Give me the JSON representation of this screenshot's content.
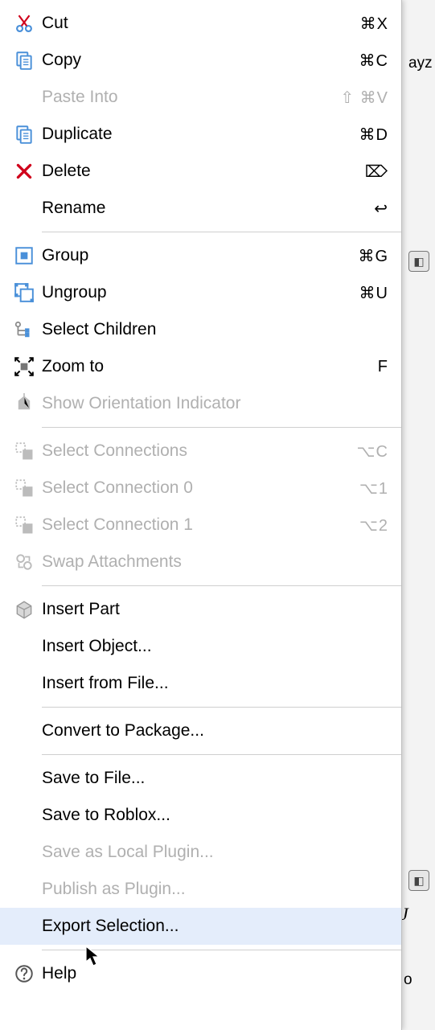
{
  "menu": {
    "sections": [
      [
        {
          "id": "cut",
          "label": "Cut",
          "shortcut": "⌘X",
          "disabled": false,
          "icon": "cut-icon"
        },
        {
          "id": "copy",
          "label": "Copy",
          "shortcut": "⌘C",
          "disabled": false,
          "icon": "copy-icon"
        },
        {
          "id": "paste-into",
          "label": "Paste Into",
          "shortcut": "⇧ ⌘V",
          "disabled": true,
          "icon": ""
        },
        {
          "id": "duplicate",
          "label": "Duplicate",
          "shortcut": "⌘D",
          "disabled": false,
          "icon": "duplicate-icon"
        },
        {
          "id": "delete",
          "label": "Delete",
          "shortcut": "⌦",
          "disabled": false,
          "icon": "delete-icon"
        },
        {
          "id": "rename",
          "label": "Rename",
          "shortcut": "↩",
          "disabled": false,
          "icon": ""
        }
      ],
      [
        {
          "id": "group",
          "label": "Group",
          "shortcut": "⌘G",
          "disabled": false,
          "icon": "group-icon"
        },
        {
          "id": "ungroup",
          "label": "Ungroup",
          "shortcut": "⌘U",
          "disabled": false,
          "icon": "ungroup-icon"
        },
        {
          "id": "select-children",
          "label": "Select Children",
          "shortcut": "",
          "disabled": false,
          "icon": "select-children-icon"
        },
        {
          "id": "zoom-to",
          "label": "Zoom to",
          "shortcut": "F",
          "disabled": false,
          "icon": "zoom-to-icon"
        },
        {
          "id": "show-orientation",
          "label": "Show Orientation Indicator",
          "shortcut": "",
          "disabled": true,
          "icon": "orientation-icon"
        }
      ],
      [
        {
          "id": "select-connections",
          "label": "Select Connections",
          "shortcut": "⌥C",
          "disabled": true,
          "icon": "select-connections-icon"
        },
        {
          "id": "select-connection-0",
          "label": "Select Connection 0",
          "shortcut": "⌥1",
          "disabled": true,
          "icon": "select-connection-0-icon"
        },
        {
          "id": "select-connection-1",
          "label": "Select Connection 1",
          "shortcut": "⌥2",
          "disabled": true,
          "icon": "select-connection-1-icon"
        },
        {
          "id": "swap-attachments",
          "label": "Swap Attachments",
          "shortcut": "",
          "disabled": true,
          "icon": "swap-attachments-icon"
        }
      ],
      [
        {
          "id": "insert-part",
          "label": "Insert Part",
          "shortcut": "",
          "disabled": false,
          "icon": "insert-part-icon"
        },
        {
          "id": "insert-object",
          "label": "Insert Object...",
          "shortcut": "",
          "disabled": false,
          "icon": ""
        },
        {
          "id": "insert-from-file",
          "label": "Insert from File...",
          "shortcut": "",
          "disabled": false,
          "icon": ""
        }
      ],
      [
        {
          "id": "convert-to-package",
          "label": "Convert to Package...",
          "shortcut": "",
          "disabled": false,
          "icon": ""
        }
      ],
      [
        {
          "id": "save-to-file",
          "label": "Save to File...",
          "shortcut": "",
          "disabled": false,
          "icon": ""
        },
        {
          "id": "save-to-roblox",
          "label": "Save to Roblox...",
          "shortcut": "",
          "disabled": false,
          "icon": ""
        },
        {
          "id": "save-as-local-plugin",
          "label": "Save as Local Plugin...",
          "shortcut": "",
          "disabled": true,
          "icon": ""
        },
        {
          "id": "publish-as-plugin",
          "label": "Publish as Plugin...",
          "shortcut": "",
          "disabled": true,
          "icon": ""
        },
        {
          "id": "export-selection",
          "label": "Export Selection...",
          "shortcut": "",
          "disabled": false,
          "icon": "",
          "hovered": true
        }
      ],
      [
        {
          "id": "help",
          "label": "Help",
          "shortcut": "",
          "disabled": false,
          "icon": "help-icon"
        }
      ]
    ]
  },
  "backdrop": {
    "tab_fragment": "ayz",
    "italic_char": "J",
    "o_char": "o"
  }
}
